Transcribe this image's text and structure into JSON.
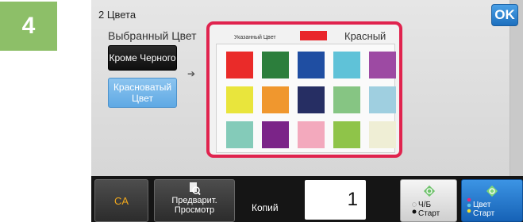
{
  "step": {
    "number": "4"
  },
  "header": {
    "mode_title": "2 Цвета",
    "ok_label": "OK"
  },
  "selected": {
    "label": "Выбранный Цвет",
    "buttons": [
      {
        "label": "Кроме Черного"
      },
      {
        "label": "Красноватый Цвет"
      }
    ]
  },
  "palette": {
    "specified_label": "Указанный Цвет",
    "current_name": "Красный",
    "swatch_color": "#e9262b",
    "colors": [
      "#ea2b29",
      "#2c7e3c",
      "#1f4ea2",
      "#5fc2d8",
      "#9d4aa3",
      "#e9e53c",
      "#f0972e",
      "#262e63",
      "#86c583",
      "#9fcfe0",
      "#84cbb9",
      "#7b2488",
      "#f3a9bd",
      "#8fc449",
      "#efeed5"
    ]
  },
  "footer": {
    "ca": "CA",
    "preview": "Предварит. Просмотр",
    "copies_label": "Копий",
    "copies_value": "1",
    "bw_label": "Ч/Б Старт",
    "color_label": "Цвет Старт"
  },
  "colors": {
    "accent": "#8dbf68",
    "highlight": "#e0234e",
    "blue": "#1d6fbe"
  }
}
